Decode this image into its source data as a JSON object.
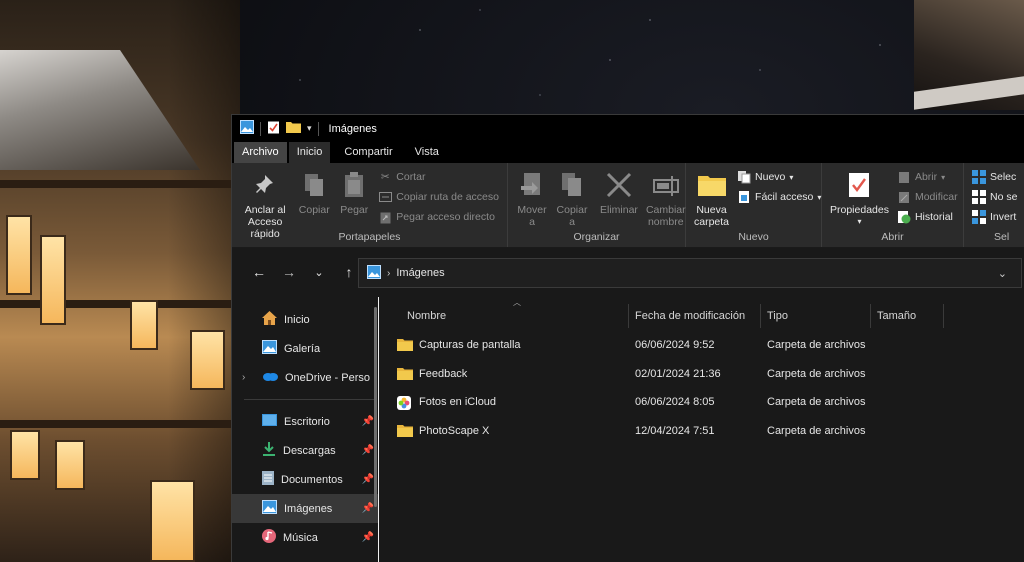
{
  "window": {
    "title": "Imágenes"
  },
  "ribbon_tabs": [
    "Archivo",
    "Inicio",
    "Compartir",
    "Vista"
  ],
  "ribbon": {
    "portapapeles": {
      "label": "Portapapeles",
      "pin_label_1": "Anclar al",
      "pin_label_2": "Acceso rápido",
      "copy_label": "Copiar",
      "paste_label": "Pegar",
      "cut_label": "Cortar",
      "copy_path_label": "Copiar ruta de acceso",
      "paste_shortcut_label": "Pegar acceso directo"
    },
    "organizar": {
      "label": "Organizar",
      "move_label_1": "Mover",
      "move_label_2": "a",
      "copyto_label_1": "Copiar",
      "copyto_label_2": "a",
      "delete_label": "Eliminar",
      "rename_label_1": "Cambiar",
      "rename_label_2": "nombre"
    },
    "nuevo": {
      "label": "Nuevo",
      "new_folder_label_1": "Nueva",
      "new_folder_label_2": "carpeta",
      "new_item_label": "Nuevo",
      "easy_access_label": "Fácil acceso"
    },
    "abrir": {
      "label": "Abrir",
      "properties_label": "Propiedades",
      "open_label": "Abrir",
      "edit_label": "Modificar",
      "history_label": "Historial"
    },
    "seleccionar": {
      "label": "Sel",
      "select_all_label": "Selec",
      "select_none_label": "No se",
      "invert_label": "Invert"
    }
  },
  "address": {
    "crumb": "Imágenes"
  },
  "navpane": {
    "items": [
      {
        "label": "Inicio",
        "icon": "home-icon"
      },
      {
        "label": "Galería",
        "icon": "gallery-icon"
      },
      {
        "label": "OneDrive - Perso",
        "icon": "onedrive-icon"
      },
      {
        "label": "Escritorio",
        "icon": "desktop-icon"
      },
      {
        "label": "Descargas",
        "icon": "downloads-icon"
      },
      {
        "label": "Documentos",
        "icon": "documents-icon"
      },
      {
        "label": "Imágenes",
        "icon": "pictures-icon"
      },
      {
        "label": "Música",
        "icon": "music-icon"
      }
    ]
  },
  "columns": {
    "name": "Nombre",
    "date": "Fecha de modificación",
    "type": "Tipo",
    "size": "Tamaño"
  },
  "files": [
    {
      "name": "Capturas de pantalla",
      "date": "06/06/2024 9:52",
      "type": "Carpeta de archivos",
      "icon": "folder-icon"
    },
    {
      "name": "Feedback",
      "date": "02/01/2024 21:36",
      "type": "Carpeta de archivos",
      "icon": "folder-icon"
    },
    {
      "name": "Fotos en iCloud",
      "date": "06/06/2024 8:05",
      "type": "Carpeta de archivos",
      "icon": "icloud-photos-icon"
    },
    {
      "name": "PhotoScape X",
      "date": "12/04/2024 7:51",
      "type": "Carpeta de archivos",
      "icon": "folder-icon"
    }
  ],
  "colors": {
    "window_bg": "#191919",
    "ribbon_bg": "#2b2b2b",
    "folder": "#f2c94c",
    "accent": "#3a96dd"
  }
}
